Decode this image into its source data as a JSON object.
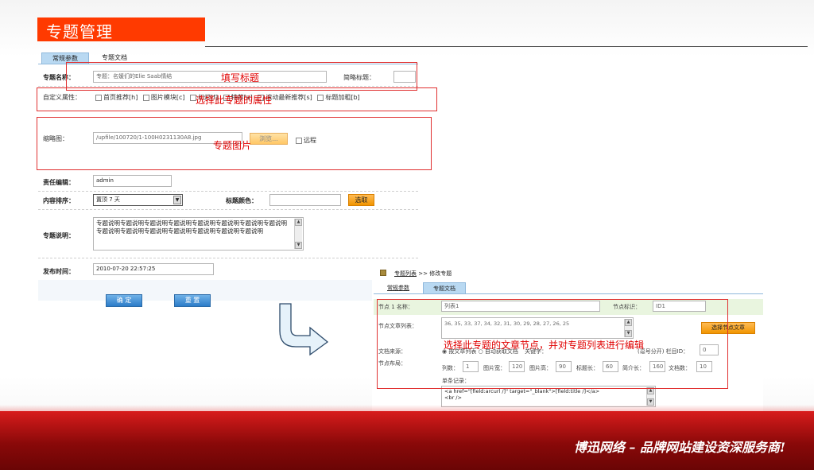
{
  "slide": {
    "title": "专题管理",
    "slogan": "博迅网络 – 品牌网站建设资深服务商!"
  },
  "form": {
    "tabs": [
      "常规参数",
      "专题文档"
    ],
    "name_label": "专题名称：",
    "name_value": "专题：名媛们的Elie Saab情结",
    "short_title_label": "简略标题：",
    "attr_label": "自定义属性：",
    "attrs": [
      "首页推荐[h]",
      "图片模块[c]",
      "幻灯[f]",
      "特荐[a]",
      "滚动最新推荐[s]",
      "标题加粗[b]"
    ],
    "thumb_label": "缩略图：",
    "thumb_value": "/upfile/100720/1-100H0231130A8.jpg",
    "browse_label": "浏览...",
    "remote_label": "远程",
    "editor_label": "责任编辑：",
    "editor_value": "admin",
    "order_label": "内容排序：",
    "order_value": "置顶 7 天",
    "color_label": "标题颜色：",
    "pick_label": "选取",
    "desc_label": "专题说明：",
    "desc_value": "专题说明专题说明专题说明专题说明专题说明专题说明专题说明专题说明专题说明专题说明专题说明专题说明专题说明专题说明专题说明",
    "time_label": "发布时间：",
    "time_value": "2010-07-20 22:57:25",
    "ok_label": "确 定",
    "reset_label": "重 置"
  },
  "notes": {
    "fill_title": "填写标题",
    "select_attr": "选择此专题的属性",
    "thumb": "专题图片",
    "nodes": "选择此专题的文章节点，并对专题列表进行编辑"
  },
  "panel2": {
    "breadcrumb_link": "专题列表",
    "breadcrumb_sep": ">>",
    "breadcrumb_current": "修改专题",
    "tabs": [
      "常规参数",
      "专题文档"
    ],
    "node_label": "节点 1 名称：",
    "node_value": "列表1",
    "node_id_label": "节点标识：",
    "node_id_value": "ID1",
    "list_label": "节点文章列表：",
    "list_value": "36, 35, 33, 37, 34, 32, 31, 30, 29, 28, 27, 26, 25",
    "select_btn": "选择节点文章",
    "source_label": "文档来源：",
    "source_opt1": "按文章列表",
    "source_opt2": "自动获取文档",
    "keyword_label": "关键字：",
    "comma_note": "(逗号分开) 栏目ID：",
    "column_id_value": "0",
    "layout_label": "节点布局：",
    "cols_label": "列数：",
    "cols_value": "1",
    "imgw_label": "图片宽：",
    "imgw_value": "120",
    "imgh_label": "图片高：",
    "imgh_value": "90",
    "titlelen_label": "标题长：",
    "titlelen_value": "60",
    "introlen_label": "简介长：",
    "introlen_value": "160",
    "docs_label": "文档数：",
    "docs_value": "10",
    "record_label": "单条记录：",
    "record_line1": "<a href=\"[field:arcurl /]\" target=\"_blank\">[field:title /]</a>",
    "record_line2": "<br />"
  },
  "colors": {
    "title_bg": "#ff3a00",
    "note_red": "#e00000",
    "band_red": "#c41414",
    "tab_blue": "#b9d9f2",
    "button_orange": "#f19500",
    "button_blue": "#2c7cc8"
  }
}
